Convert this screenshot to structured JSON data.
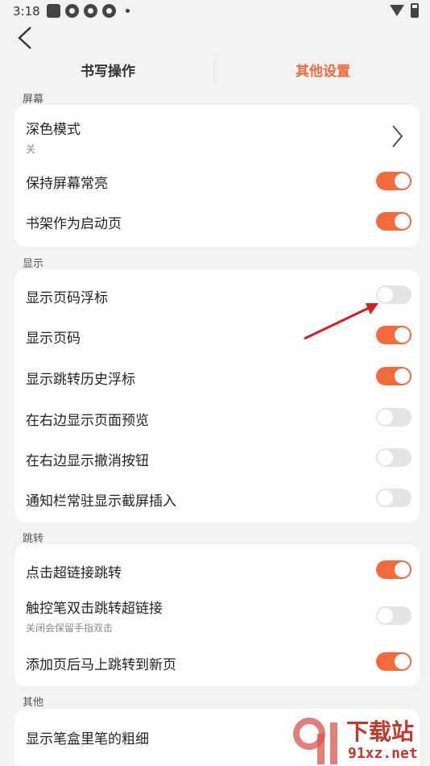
{
  "status_bar": {
    "time": "3:18"
  },
  "tabs": [
    {
      "label": "书写操作"
    },
    {
      "label": "其他设置"
    }
  ],
  "accent_color": "#f46a3a",
  "sections": {
    "screen": {
      "label": "屏幕",
      "dark_mode": {
        "label": "深色模式",
        "sub": "关"
      },
      "keep_screen_on": {
        "label": "保持屏幕常亮",
        "on": true
      },
      "bookshelf_start": {
        "label": "书架作为启动页",
        "on": true
      }
    },
    "display": {
      "label": "显示",
      "page_float": {
        "label": "显示页码浮标",
        "on": false
      },
      "page_number": {
        "label": "显示页码",
        "on": true
      },
      "jump_history_float": {
        "label": "显示跳转历史浮标",
        "on": true
      },
      "right_preview": {
        "label": "在右边显示页面预览",
        "on": false
      },
      "right_undo": {
        "label": "在右边显示撤消按钮",
        "on": false
      },
      "notify_screenshot": {
        "label": "通知栏常驻显示截屏插入",
        "on": false
      }
    },
    "jump": {
      "label": "跳转",
      "hyperlink_click": {
        "label": "点击超链接跳转",
        "on": true
      },
      "stylus_double": {
        "label": "触控笔双击跳转超链接",
        "sub": "关闭会保留手指双击",
        "on": false
      },
      "add_page_jump": {
        "label": "添加页后马上跳转到新页",
        "on": true
      }
    },
    "other": {
      "label": "其他",
      "pen_thickness": {
        "label": "显示笔盒里笔的粗细"
      }
    }
  },
  "watermark": {
    "title": "下载站",
    "url": "91xz.net"
  }
}
